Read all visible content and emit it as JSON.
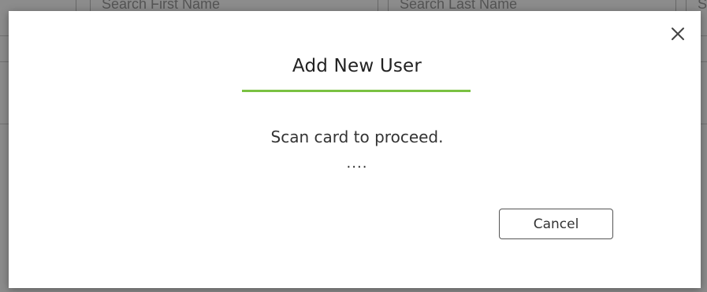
{
  "background": {
    "search_first_placeholder": "Search First Name",
    "search_last_placeholder": "Search Last Name",
    "search_third_placeholder": "S"
  },
  "modal": {
    "title": "Add New User",
    "message": "Scan card to proceed.",
    "progress_dots": "....",
    "cancel_label": "Cancel",
    "close_icon": "close-icon"
  },
  "colors": {
    "accent_underline": "#7ac142",
    "overlay": "#8a8a8a",
    "button_border": "#555555"
  }
}
